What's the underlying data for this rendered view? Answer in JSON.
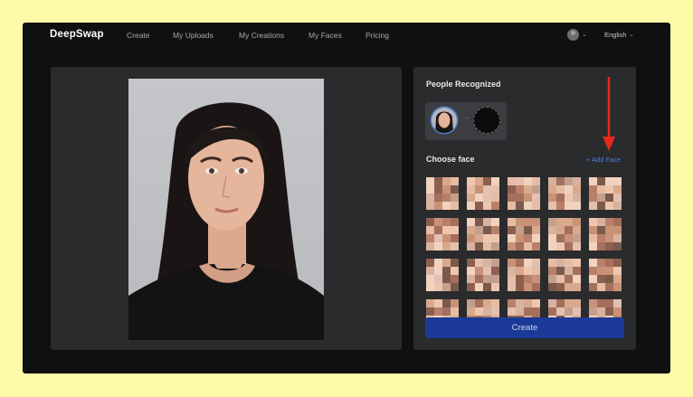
{
  "nav": {
    "logo": "DeepSwap",
    "links": [
      "Create",
      "My Uploads",
      "My Creations",
      "My Faces",
      "Pricing"
    ],
    "language": "English"
  },
  "panel": {
    "people_title": "People Recognized",
    "choose_title": "Choose face",
    "add_face": "+ Add Face",
    "create_label": "Create"
  },
  "colors": {
    "accent_blue": "#1b3a97",
    "link_blue": "#4d7fe3",
    "annotation_red": "#e8261e"
  }
}
